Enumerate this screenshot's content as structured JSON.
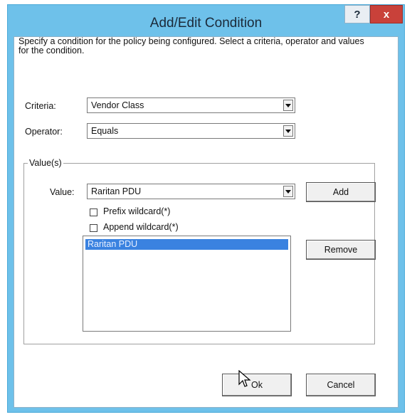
{
  "window": {
    "title": "Add/Edit Condition",
    "help_label": "?",
    "close_label": "x"
  },
  "description": "Specify a condition for the policy being configured. Select a criteria, operator and values for the condition.",
  "criteria": {
    "label": "Criteria:",
    "value": "Vendor Class"
  },
  "operator": {
    "label": "Operator:",
    "value": "Equals"
  },
  "values_group": {
    "label": "Value(s)",
    "value_label": "Value:",
    "value": "Raritan PDU",
    "add_label": "Add",
    "prefix_wildcard": {
      "label": "Prefix wildcard(*)",
      "checked": false
    },
    "append_wildcard": {
      "label": "Append wildcard(*)",
      "checked": false
    },
    "list_items": [
      "Raritan PDU"
    ],
    "remove_label": "Remove"
  },
  "footer": {
    "ok_label": "Ok",
    "cancel_label": "Cancel"
  },
  "colors": {
    "titlebar": "#6ec1ea",
    "close_button": "#c9413a",
    "selection": "#3a82e0"
  }
}
